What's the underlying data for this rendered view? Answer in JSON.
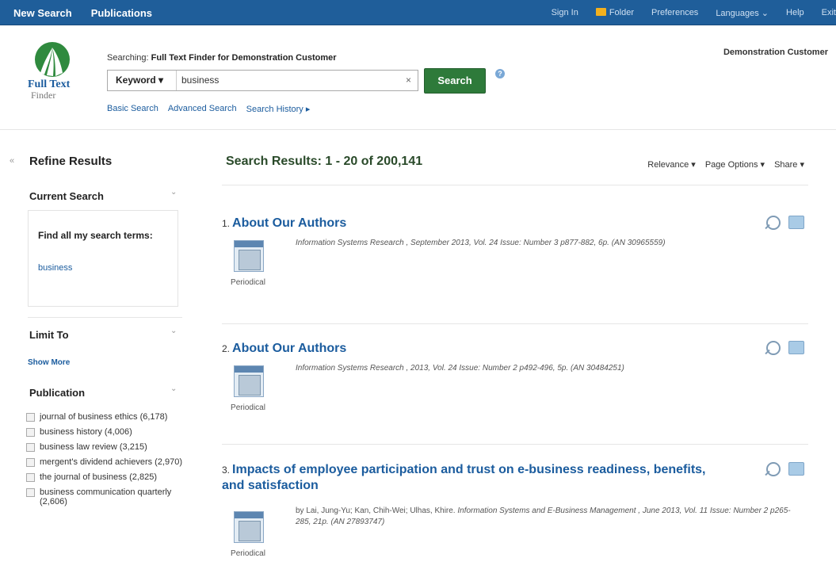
{
  "topnav": {
    "new_search": "New Search",
    "publications": "Publications",
    "sign_in": "Sign In",
    "folder": "Folder",
    "preferences": "Preferences",
    "languages": "Languages ⌄",
    "help": "Help",
    "exit": "Exit"
  },
  "header": {
    "logo_line1": "Full Text",
    "logo_line2": "Finder",
    "searching_prefix": "Searching:",
    "searching_target": "Full Text Finder for Demonstration Customer",
    "field_label": "Keyword ▾",
    "query_value": "business",
    "clear": "×",
    "search_button": "Search",
    "help": "?",
    "links": [
      "Basic Search",
      "Advanced Search",
      "Search History ▸"
    ],
    "customer": "Demonstration Customer"
  },
  "sidebar": {
    "collapse": "«",
    "refine_title": "Refine Results",
    "current_search": "Current Search",
    "find_all": "Find all my search terms:",
    "term": "business",
    "limit_to": "Limit To",
    "show_more": "Show More",
    "publication": "Publication",
    "publications": [
      "journal of business ethics (6,178)",
      "business history (4,006)",
      "business law review (3,215)",
      "mergent's dividend achievers (2,970)",
      "the journal of business (2,825)",
      "business communication quarterly (2,606)"
    ]
  },
  "results": {
    "title": "Search Results: 1 - 20 of 200,141",
    "relevance": "Relevance ▾",
    "page_options": "Page Options ▾",
    "share": "Share ▾",
    "items": [
      {
        "num": "1.",
        "title": "About Our Authors",
        "byline": "",
        "source": "Information Systems Research , September 2013, Vol. 24 Issue: Number 3 p877-882, 6p. (AN 30965559)",
        "type": "Periodical"
      },
      {
        "num": "2.",
        "title": "About Our Authors",
        "byline": "",
        "source": "Information Systems Research , 2013, Vol. 24 Issue: Number 2 p492-496, 5p. (AN 30484251)",
        "type": "Periodical"
      },
      {
        "num": "3.",
        "title": "Impacts of employee participation and trust on e-business readiness, benefits, and satisfaction",
        "byline": "by Lai, Jung-Yu; Kan, Chih-Wei; Ulhas, Khire.",
        "source": "Information Systems and E-Business Management , June 2013, Vol. 11 Issue: Number 2 p265-285, 21p. (AN 27893747)",
        "type": "Periodical"
      }
    ]
  },
  "colors": {
    "nav": "#1f5e9a",
    "search_button": "#2e7a3a",
    "link": "#1b5c9e"
  }
}
